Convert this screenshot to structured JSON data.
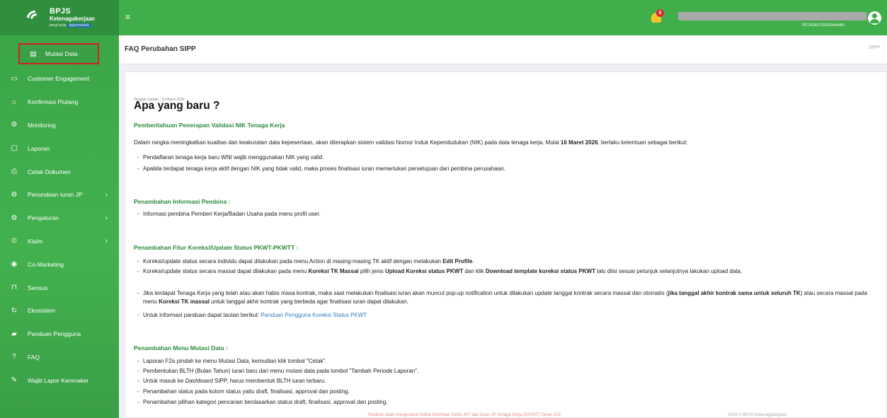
{
  "brand": {
    "name": "BPJS",
    "sub": "Ketenagakerjaan",
    "tag_prefix": "pergi kerja",
    "tag": "bpjamsostek"
  },
  "topbar": {
    "menu_glyph": "≡",
    "notif_count": "0",
    "role": "PETUGAS PERUSAHAAN"
  },
  "sidebar": {
    "items": [
      {
        "label": "Mutasi Data",
        "icon": "document-icon",
        "glyph": "▤"
      },
      {
        "label": "Customer Engagement",
        "icon": "chat-icon",
        "glyph": "▭"
      },
      {
        "label": "Konfirmasi Piutang",
        "icon": "home-icon",
        "glyph": "⌂"
      },
      {
        "label": "Monitoring",
        "icon": "gear-icon",
        "glyph": "⚙"
      },
      {
        "label": "Laporan",
        "icon": "report-icon",
        "glyph": "▢"
      },
      {
        "label": "Cetak Dokumen",
        "icon": "print-icon",
        "glyph": "⎙"
      },
      {
        "label": "Penundaan Iuran JP",
        "icon": "settings-icon",
        "glyph": "⚙",
        "has_chevron": true
      },
      {
        "label": "Pengaturan",
        "icon": "settings-icon",
        "glyph": "⚙",
        "has_chevron": true
      },
      {
        "label": "Klaim",
        "icon": "clock-icon",
        "glyph": "⊙",
        "has_chevron": true
      },
      {
        "label": "Co-Marketing",
        "icon": "target-icon",
        "glyph": "◉"
      },
      {
        "label": "Sensus",
        "icon": "bookmark-icon",
        "glyph": "⊓"
      },
      {
        "label": "Ekosistem",
        "icon": "refresh-icon",
        "glyph": "↻"
      },
      {
        "label": "Panduan Pengguna",
        "icon": "book-icon",
        "glyph": "▰"
      },
      {
        "label": "FAQ",
        "icon": "help-icon",
        "glyph": "?"
      },
      {
        "label": "Wajib Lapor Kemnaker",
        "icon": "leaf-icon",
        "glyph": "✎"
      }
    ],
    "chevron": "›"
  },
  "page": {
    "title": "FAQ Perubahan SIPP",
    "breadcrumb": "SIPP"
  },
  "content": {
    "updated": "Tanggal Update : 16 Maret 2026",
    "heading": "Apa yang baru ?",
    "s1_title": "Pemberitahuan Penerapan Validasi NIK Tenaga Kerja",
    "s1_p_a": "Dalam rangka meningkatkan kualitas dan keakuratan data kepesertaan, akan diterapkan sistem validasi Nomor Induk Kependudukan (NIK) pada data tenaga kerja. Mulai ",
    "s1_p_b": "16 Maret 2026",
    "s1_p_c": ", berlaku ketentuan sebagai berikut:",
    "s1_li1": "Pendaftaran tenaga kerja baru WNI wajib menggunakan NIK yang valid.",
    "s1_li2": "Apabila terdapat tenaga kerja aktif dengan NIK yang tidak valid, maka proses finalisasi iuran memerlukan persetujuan dari pembina perusahaan.",
    "s2_title": "Penambahan Informasi Pembina :",
    "s2_li1": "Informasi pembina Pemberi Kerja/Badan Usaha pada menu profil user.",
    "s3_title": "Penambahan Fitur Koreksi/Update Status PKWT-PKWTT :",
    "s3_li1_a": "Koreksi/update status secara individu dapat dilakukan pada menu Action di masing-masing TK aktif dengan melakukan ",
    "s3_li1_b": "Edit Profile",
    "s3_li1_c": ".",
    "s3_li2_a": "Koreksi/update status secara massal dapat dilakukan pada menu ",
    "s3_li2_b": "Koreksi TK Massal",
    "s3_li2_c": " pilih jenis ",
    "s3_li2_d": "Upload Koreksi status PKWT",
    "s3_li2_e": " dan klik ",
    "s3_li2_f": "Download template koreksi status PKWT",
    "s3_li2_g": " lalu diisi sesuai petunjuk selanjutnya lakukan upload data.",
    "s3_li3_a": "Jika terdapat Tenaga Kerja yang telah atau akan habis masa kontrak, maka saat melakukan finalisasi iuran akan muncul pop-up notification untuk dilakukan update tanggal kontrak secara massal dan otomatis (",
    "s3_li3_b": "jika tanggal akhir kontrak sama untuk seluruh TK",
    "s3_li3_c": ") atau secara massal pada menu ",
    "s3_li3_d": "Koreksi TK massal",
    "s3_li3_e": " untuk tanggal akhir kontrak yang berbeda agar finalisasi iuran dapat dilakukan.",
    "s3_li4_a": "Untuk informasi panduan dapat tautan berikut: ",
    "s3_li4_link": "Panduan Pengguna Koreksi Status PKWT",
    "s4_title": "Penambahan Menu Mutasi Data :",
    "s4_li1": "Laporan F2a pindah ke menu Mutasi Data, kemudian klik tombol \"Cetak\".",
    "s4_li2": "Pembentukan BLTH (Bulan Tahun) iuran baru dari menu mutasi data pada tombol \"Tambah Periode Laporan\".",
    "s4_li3_a": "Untuk masuk ke ",
    "s4_li3_b": "Dashboard",
    "s4_li3_c": " SIPP, harus membentuk BLTH iuran terbaru.",
    "s4_li4": "Penambahan status pada kolom status yaitu draft, finalisasi, approval dan posting.",
    "s4_li5": "Penambahan pilihan kategori pencarian berdasarkan status draft, finalisasi, approval dan posting."
  },
  "footer": {
    "left": "Pastikan telah mengunduh Daftar Informasi Saldo JHT dan Iuran JP Tenaga Kerja (DSJHT) Tahun 202",
    "right": "2026 © BPJS Ketenagakerjaan"
  },
  "colors": {
    "sidebar": "#43b14f",
    "topbar": "#3fae4b",
    "section": "#2b8a3a",
    "active_border": "#d42020",
    "link": "#2e7fc3"
  }
}
